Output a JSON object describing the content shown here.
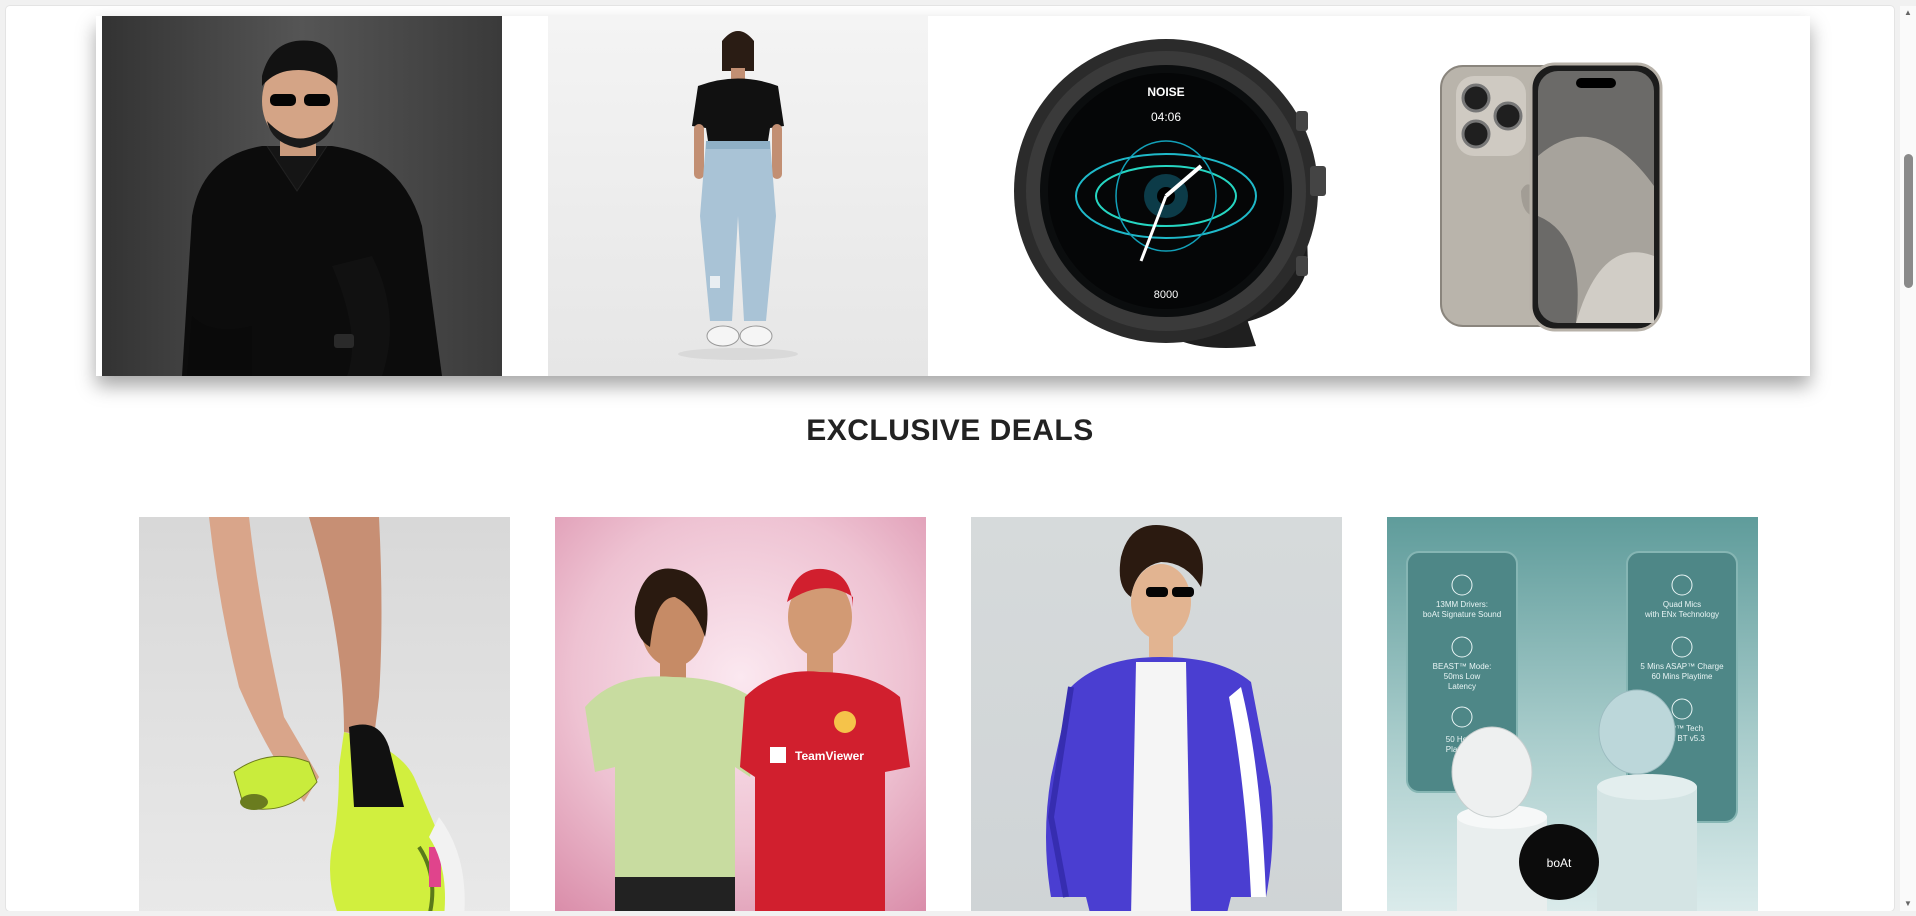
{
  "section": {
    "title": "EXCLUSIVE DEALS"
  },
  "carousel": {
    "slides": [
      {
        "name": "man-in-black-shirt"
      },
      {
        "name": "woman-in-jeans"
      },
      {
        "name": "smartwatch"
      },
      {
        "name": "smartphone"
      }
    ],
    "watch": {
      "brand": "NOISE",
      "time": "04:06",
      "steps": "8000"
    }
  },
  "deals": {
    "items": [
      {
        "name": "sneakers"
      },
      {
        "name": "sports-jerseys"
      },
      {
        "name": "track-jacket"
      },
      {
        "name": "earbuds"
      }
    ],
    "earbuds_features": {
      "left": [
        "13MM Drivers:",
        "boAt Signature Sound",
        "BEAST™ Mode:",
        "50ms Low",
        "Latency",
        "50 Hours",
        "Playback"
      ],
      "right": [
        "Quad Mics",
        "with ENx Technology",
        "5 Mins ASAP™ Charge",
        "60 Mins Playtime",
        "IWP™ Tech",
        "With BT v5.3"
      ]
    },
    "earbud_brand": "boAt",
    "jersey_sponsor": "TeamViewer"
  },
  "scrollbar": {
    "position": 0.2
  }
}
